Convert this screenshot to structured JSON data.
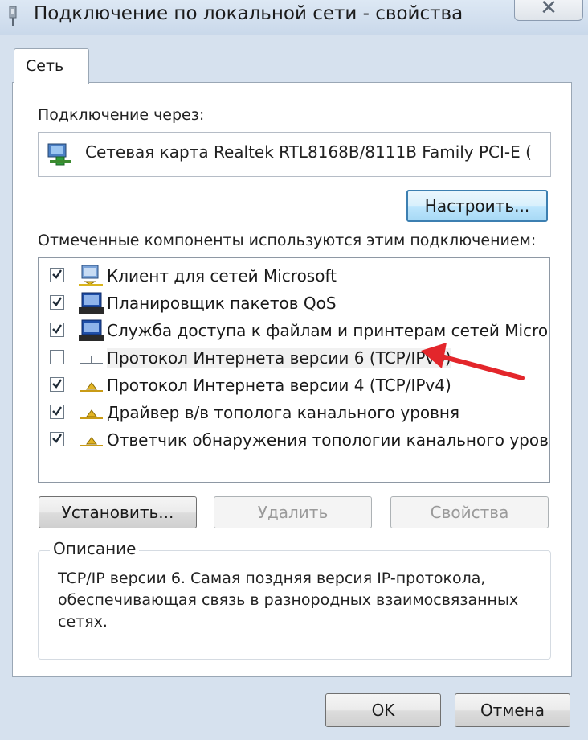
{
  "window": {
    "title": "Подключение по локальной сети - свойства",
    "close_glyph": "✕"
  },
  "tabs": [
    {
      "label": "Сеть",
      "selected": true
    }
  ],
  "connect_via": {
    "label": "Подключение через:",
    "adapter": "Сетевая карта Realtek RTL8168B/8111B Family PCI-E (",
    "adapter_icon": "network-adapter-icon",
    "configure_button": "Настроить..."
  },
  "components": {
    "label": "Отмеченные компоненты используются этим подключением:",
    "items": [
      {
        "label": "Клиент для сетей Microsoft",
        "checked": true,
        "icon": "client-icon"
      },
      {
        "label": "Планировщик пакетов QoS",
        "checked": true,
        "icon": "service-icon"
      },
      {
        "label": "Служба доступа к файлам и принтерам сетей Micro...",
        "checked": true,
        "icon": "service-icon"
      },
      {
        "label": "Протокол Интернета версии 6 (TCP/IPv6)",
        "checked": false,
        "icon": "protocol-icon",
        "selected": true
      },
      {
        "label": "Протокол Интернета версии 4 (TCP/IPv4)",
        "checked": true,
        "icon": "protocol-icon"
      },
      {
        "label": "Драйвер в/в тополога канального уровня",
        "checked": true,
        "icon": "protocol-icon"
      },
      {
        "label": "Ответчик обнаружения топологии канального уровня",
        "checked": true,
        "icon": "protocol-icon"
      }
    ]
  },
  "actions": {
    "install": "Установить...",
    "remove": "Удалить",
    "properties": "Свойства"
  },
  "description": {
    "legend": "Описание",
    "text": "TCP/IP версии 6. Самая поздняя версия IP-протокола, обеспечивающая связь в разнородных взаимосвязанных сетях."
  },
  "footer": {
    "ok": "OK",
    "cancel": "Отмена"
  },
  "colors": {
    "accent": "#3c7fb1",
    "annotation_arrow": "#e3262b"
  }
}
